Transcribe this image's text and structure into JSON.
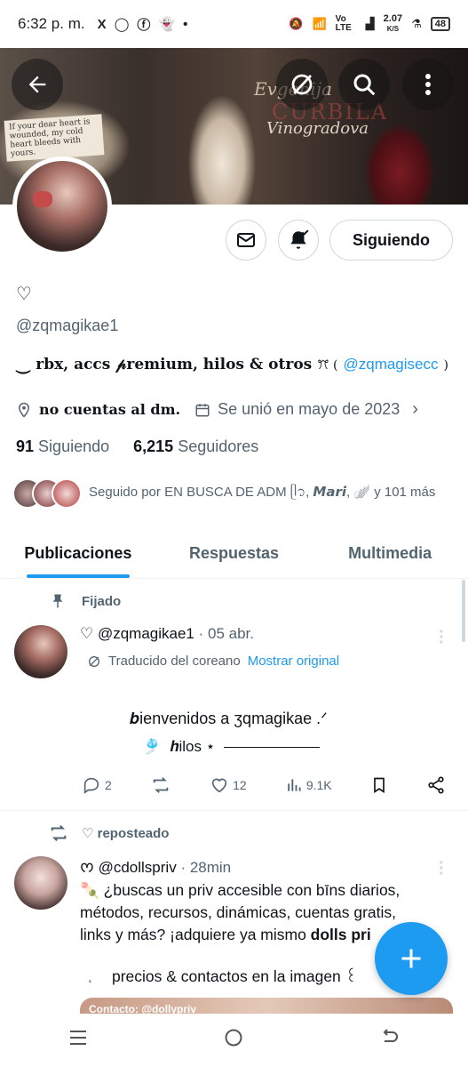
{
  "status_bar": {
    "time": "6:32 p. m.",
    "apps": [
      "X",
      "WhatsApp",
      "Facebook",
      "Snapchat",
      "•"
    ],
    "network": "Vo LTE",
    "speed": "2.07",
    "speed_unit": "K/S",
    "battery": "48"
  },
  "banner": {
    "script_line1": "Evgenija",
    "script_line2": "Vinogradova",
    "red_text": "CURBILA",
    "note": "If your dear heart is wounded, my cold heart bleeds with yours."
  },
  "profile": {
    "name_glyph": "♡",
    "handle": "@zqmagikae1",
    "bio_prefix": "⏝ rbx, accs 𝓅remium, hilos & otros",
    "bio_symbol": "ꔫ (",
    "bio_link": "@zqmagisecc",
    "bio_suffix": ")",
    "location": "no cuentas al dm.",
    "joined": "Se unió en mayo de 2023",
    "following_count": "91",
    "following_label": "Siguiendo",
    "followers_count": "6,215",
    "followers_label": "Seguidores",
    "followed_by": "Seguido por EN BUSCA DE ADM ᥫ᭡, 𝙈𝙖𝙧𝙞, 🪽 y 101 más"
  },
  "buttons": {
    "following": "Siguiendo"
  },
  "tabs": [
    {
      "label": "Publicaciones",
      "active": true
    },
    {
      "label": "Respuestas",
      "active": false
    },
    {
      "label": "Multimedia",
      "active": false
    }
  ],
  "pinned_post": {
    "pinned_label": "Fijado",
    "author": "♡ @zqmagikae1",
    "date": "· 05 abr.",
    "translated_label": "Traducido del coreano",
    "show_original": "Mostrar original",
    "line1": "𝒃ienvenidos    a    ʒqmagikae  .ᐟ",
    "line2_icon": "🎐",
    "line2_text": "𝒉ilos  ⋆",
    "replies": "2",
    "likes": "12",
    "views": "9.1K"
  },
  "repost_post": {
    "reposted_label": "♡ reposteado",
    "author": "ᰔ @cdollspriv",
    "time": "· 28min",
    "line1": "🍡  ¿buscas un priv accesible con bīns diarios,",
    "line2": "métodos, recursos, dinámicas, cuentas gratis,",
    "line3_prefix": "links y más? ¡adquiere ya mismo ",
    "line3_bold": "dolls pri",
    "line4_prefix": "˛",
    "line4": "precios & contactos en la imagen  ꒰",
    "image_caption": "Contacto: @dollypriv"
  },
  "colors": {
    "accent": "#1d9bf0",
    "text": "#0f1419",
    "muted": "#536471"
  }
}
